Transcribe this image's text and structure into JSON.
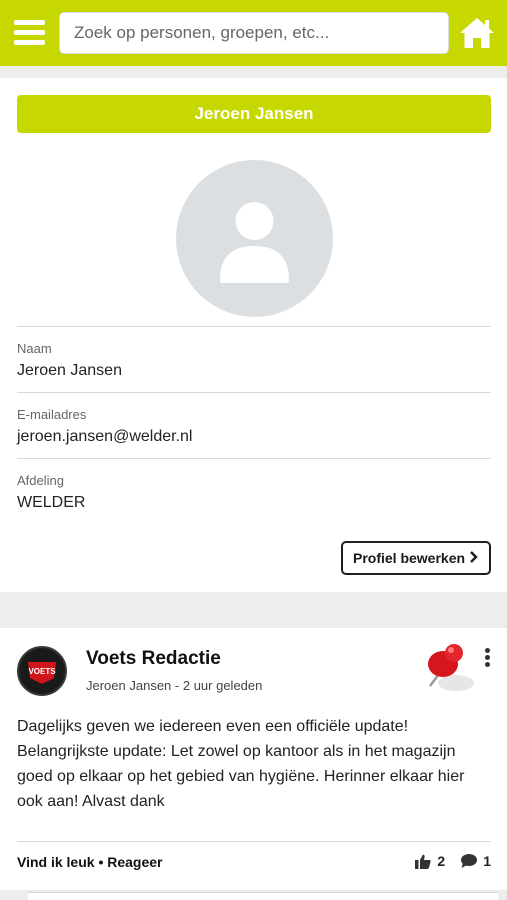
{
  "header": {
    "search_placeholder": "Zoek op personen, groepen, etc...",
    "menu_icon": "hamburger-menu-icon",
    "home_icon": "home-icon",
    "accent_color": "#c6d800"
  },
  "profile": {
    "name": "Jeroen Jansen",
    "avatar_icon": "user-placeholder-icon",
    "fields": [
      {
        "label": "Naam",
        "value": "Jeroen Jansen"
      },
      {
        "label": "E-mailadres",
        "value": "jeroen.jansen@welder.nl"
      },
      {
        "label": "Afdeling",
        "value": "WELDER"
      }
    ],
    "edit_button_label": "Profiel bewerken",
    "edit_button_icon": "chevron-right-icon"
  },
  "post": {
    "author": "Voets Redactie",
    "author_avatar_text": "VOETS",
    "posted_by": "Jeroen Jansen",
    "time": "2 uur geleden",
    "pinned_icon": "pushpin-icon",
    "more_icon": "vertical-dots-icon",
    "body": "Dagelijks geven we iedereen even een officiële update! Belangrijkste update: Let zowel op kantoor als in het magazijn goed op elkaar op het gebied van hygiëne. Herinner elkaar hier ook aan! Alvast dank",
    "like_label": "Vind ik leuk",
    "separator": "•",
    "reply_label": "Reageer",
    "like_count": "2",
    "comment_count": "1"
  }
}
